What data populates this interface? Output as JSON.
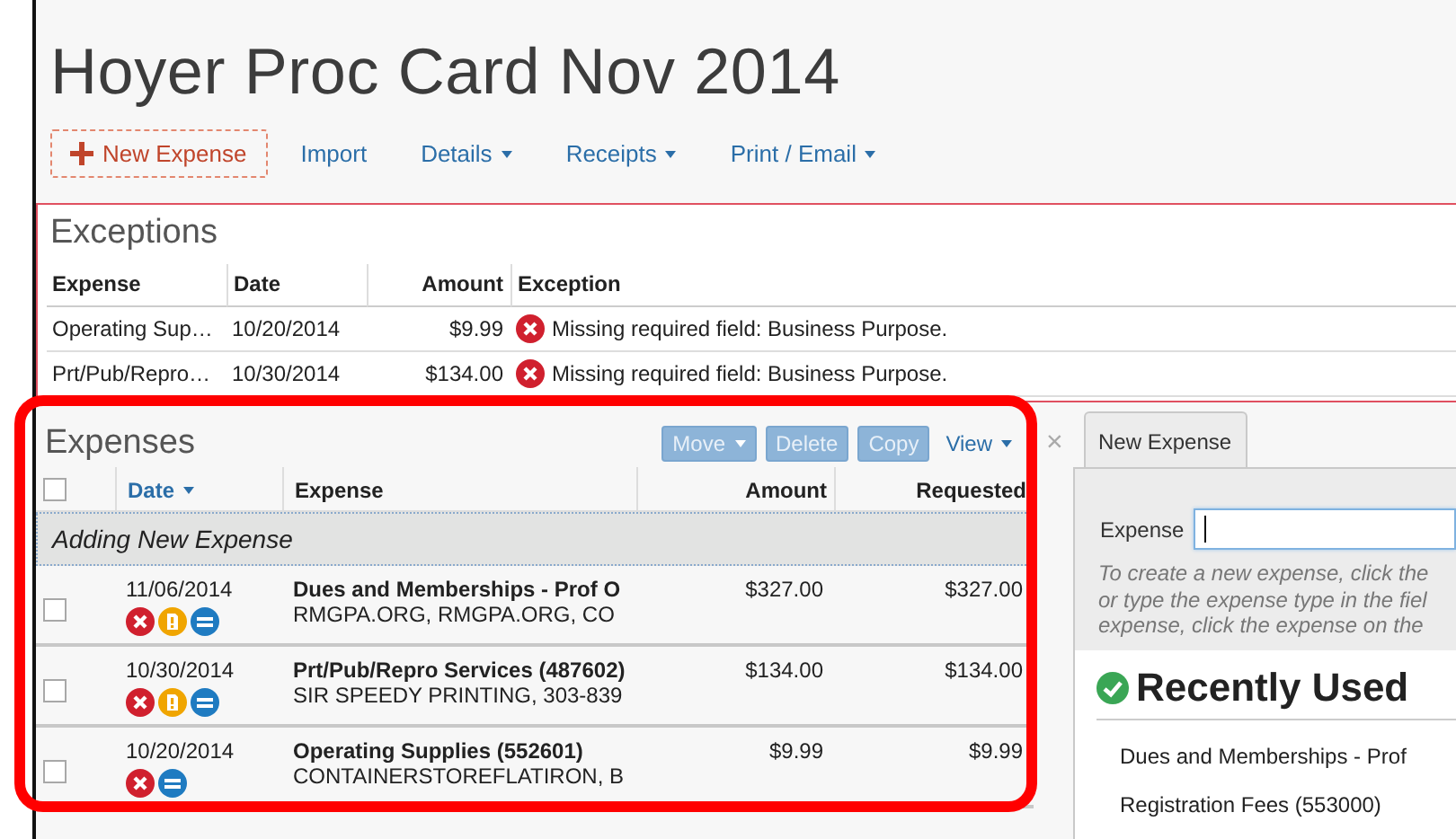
{
  "report": {
    "title": "Hoyer Proc Card Nov 2014"
  },
  "toolbar": [
    {
      "label": "New Expense",
      "kind": "primary"
    },
    {
      "label": "Import",
      "kind": "link"
    },
    {
      "label": "Details",
      "kind": "menu"
    },
    {
      "label": "Receipts",
      "kind": "menu"
    },
    {
      "label": "Print / Email",
      "kind": "menu"
    }
  ],
  "exceptions": {
    "title": "Exceptions",
    "columns": [
      "Expense",
      "Date",
      "Amount",
      "Exception"
    ],
    "rows": [
      {
        "expense": "Operating Sup…",
        "date": "10/20/2014",
        "amount": "$9.99",
        "exception": "Missing required field: Business Purpose."
      },
      {
        "expense": "Prt/Pub/Repro…",
        "date": "10/30/2014",
        "amount": "$134.00",
        "exception": "Missing required field: Business Purpose."
      }
    ]
  },
  "expenses": {
    "title": "Expenses",
    "highlighted": true,
    "buttons": [
      {
        "label": "Move",
        "kind": "menu",
        "disabled": true
      },
      {
        "label": "Delete",
        "kind": "plain",
        "disabled": true
      },
      {
        "label": "Copy",
        "kind": "plain",
        "disabled": true
      },
      {
        "label": "View",
        "kind": "link"
      }
    ],
    "close_glyph": "×",
    "select_all": {
      "checked": false
    },
    "columns": [
      {
        "label": "Date",
        "sorted": true
      },
      {
        "label": "Expense",
        "sorted": false
      },
      {
        "label": "Amount",
        "sorted": false
      },
      {
        "label": "Requested",
        "sorted": false
      }
    ],
    "adding_row": "Adding New Expense",
    "rows": [
      {
        "checked": false,
        "date": "11/06/2014",
        "flags": [
          {
            "kind": "error"
          },
          {
            "kind": "receipt"
          },
          {
            "kind": "itemized"
          }
        ],
        "type": "Dues and Memberships - Prof O",
        "vendor": "RMGPA.ORG, RMGPA.ORG, CO",
        "amount": "$327.00",
        "requested": "$327.00"
      },
      {
        "checked": false,
        "date": "10/30/2014",
        "flags": [
          {
            "kind": "error"
          },
          {
            "kind": "receipt"
          },
          {
            "kind": "itemized"
          }
        ],
        "type": "Prt/Pub/Repro Services (487602)",
        "vendor": "SIR SPEEDY PRINTING, 303-839",
        "amount": "$134.00",
        "requested": "$134.00"
      },
      {
        "checked": false,
        "date": "10/20/2014",
        "flags": [
          {
            "kind": "error"
          },
          {
            "kind": "itemized"
          }
        ],
        "type": "Operating Supplies (552601)",
        "vendor": "CONTAINERSTOREFLATIRON, B",
        "amount": "$9.99",
        "requested": "$9.99"
      }
    ]
  },
  "new_expense": {
    "tab": {
      "label": "New Expense",
      "selected": true
    },
    "field": {
      "label": "Expense",
      "focused": true
    },
    "help_lines": [
      "To create a new expense, click the",
      "or type the expense type in the fiel",
      "expense, click the expense on the"
    ],
    "recent": {
      "title": "Recently Used",
      "items": [
        "Dues and Memberships - Prof",
        "Registration Fees (553000)"
      ]
    }
  }
}
